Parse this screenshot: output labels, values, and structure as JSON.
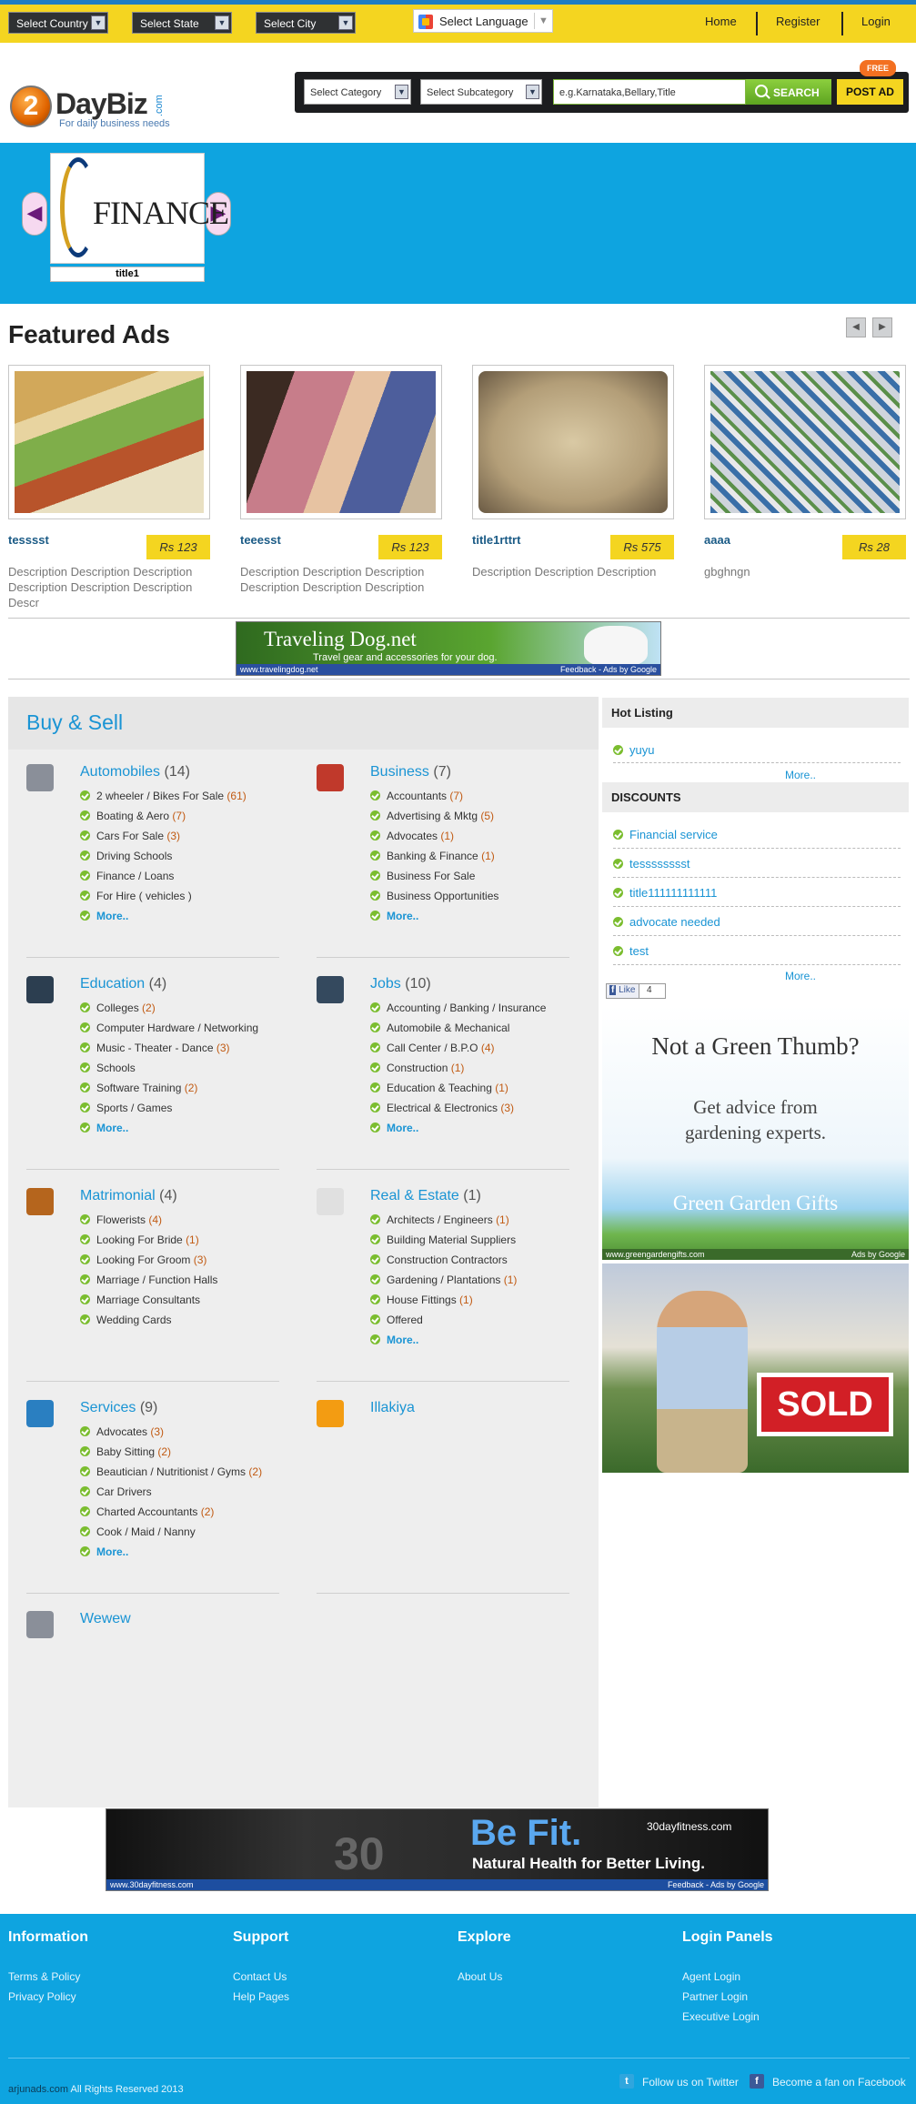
{
  "topbar": {
    "country": "Select Country",
    "state": "Select State",
    "city": "Select City",
    "language": "Select Language",
    "links": [
      "Home",
      "Register",
      "Login"
    ]
  },
  "logo": {
    "main": "2DayBiz",
    "com": ".com",
    "tagline": "For daily business needs"
  },
  "search": {
    "category": "Select Category",
    "subcategory": "Select Subcategory",
    "placeholder": "e.g.Karnataka,Bellary,Title",
    "button": "SEARCH",
    "post": "POST AD",
    "free": "FREE"
  },
  "slider": {
    "caption": "title1",
    "image_text": "FINANCE"
  },
  "featured": {
    "title": "Featured Ads",
    "items": [
      {
        "name": "tesssst",
        "price": "Rs 123",
        "desc": "Description Description Description Description Description Description Descr"
      },
      {
        "name": "teeesst",
        "price": "Rs 123",
        "desc": "Description Description Description Description Description Description"
      },
      {
        "name": "title1rttrt",
        "price": "Rs 575",
        "desc": "Description Description Description"
      },
      {
        "name": "aaaa",
        "price": "Rs 28",
        "desc": "gbghngn"
      }
    ]
  },
  "dog_ad": {
    "title": "Traveling Dog.net",
    "sub": "Travel gear and accessories for your dog.",
    "url": "www.travelingdog.net",
    "feedback": "Feedback - Ads by Google"
  },
  "buysell": {
    "title": "Buy & Sell",
    "more": "More..",
    "categories": [
      {
        "name": "Automobiles",
        "count": "(14)",
        "subs": [
          [
            "2 wheeler / Bikes For Sale",
            "(61)"
          ],
          [
            "Boating & Aero",
            "(7)"
          ],
          [
            "Cars For Sale",
            "(3)"
          ],
          [
            "Driving Schools",
            ""
          ],
          [
            "Finance / Loans",
            ""
          ],
          [
            "For Hire ( vehicles )",
            ""
          ]
        ],
        "more": true
      },
      {
        "name": "Business",
        "count": "(7)",
        "subs": [
          [
            "Accountants",
            "(7)"
          ],
          [
            "Advertising & Mktg",
            "(5)"
          ],
          [
            "Advocates",
            "(1)"
          ],
          [
            "Banking & Finance",
            "(1)"
          ],
          [
            "Business For Sale",
            ""
          ],
          [
            "Business Opportunities",
            ""
          ]
        ],
        "more": true
      },
      {
        "name": "Education",
        "count": "(4)",
        "subs": [
          [
            "Colleges",
            "(2)"
          ],
          [
            "Computer Hardware / Networking",
            ""
          ],
          [
            "Music - Theater - Dance",
            "(3)"
          ],
          [
            "Schools",
            ""
          ],
          [
            "Software Training",
            "(2)"
          ],
          [
            "Sports / Games",
            ""
          ]
        ],
        "more": true
      },
      {
        "name": "Jobs",
        "count": "(10)",
        "subs": [
          [
            "Accounting / Banking / Insurance",
            ""
          ],
          [
            "Automobile & Mechanical",
            ""
          ],
          [
            "Call Center / B.P.O",
            "(4)"
          ],
          [
            "Construction",
            "(1)"
          ],
          [
            "Education & Teaching",
            "(1)"
          ],
          [
            "Electrical & Electronics",
            "(3)"
          ]
        ],
        "more": true
      },
      {
        "name": "Matrimonial",
        "count": "(4)",
        "subs": [
          [
            "Flowerists",
            "(4)"
          ],
          [
            "Looking For Bride",
            "(1)"
          ],
          [
            "Looking For Groom",
            "(3)"
          ],
          [
            "Marriage / Function Halls",
            ""
          ],
          [
            "Marriage Consultants",
            ""
          ],
          [
            "Wedding Cards",
            ""
          ]
        ],
        "more": false
      },
      {
        "name": "Real & Estate",
        "count": "(1)",
        "subs": [
          [
            "Architects / Engineers",
            "(1)"
          ],
          [
            "Building Material Suppliers",
            ""
          ],
          [
            "Construction Contractors",
            ""
          ],
          [
            "Gardening / Plantations",
            "(1)"
          ],
          [
            "House Fittings",
            "(1)"
          ],
          [
            "Offered",
            ""
          ]
        ],
        "more": true
      },
      {
        "name": "Services",
        "count": "(9)",
        "subs": [
          [
            "Advocates",
            "(3)"
          ],
          [
            "Baby Sitting",
            "(2)"
          ],
          [
            "Beautician / Nutritionist / Gyms",
            "(2)"
          ],
          [
            "Car Drivers",
            ""
          ],
          [
            "Charted Accountants",
            "(2)"
          ],
          [
            "Cook / Maid / Nanny",
            ""
          ]
        ],
        "more": true
      },
      {
        "name": "Illakiya",
        "count": "",
        "subs": [],
        "more": false
      },
      {
        "name": "Wewew",
        "count": "",
        "subs": [],
        "more": false
      }
    ]
  },
  "sidebar": {
    "hot_title": "Hot Listing",
    "hot": [
      "yuyu"
    ],
    "disc_title": "DISCOUNTS",
    "discounts": [
      "Financial service",
      "tesssssssst",
      "title111111111111",
      "advocate needed",
      "test"
    ],
    "more": "More..",
    "like": "Like",
    "like_count": "4"
  },
  "green_ad": {
    "head": "Not a Green Thumb?",
    "body1": "Get advice from",
    "body2": "gardening experts.",
    "brand": "Green Garden Gifts",
    "url": "www.greengardengifts.com",
    "feedback": "Ads by Google"
  },
  "sold_ad": {
    "sign": "SOLD"
  },
  "fit_ad": {
    "big": "Be Fit.",
    "sub": "Natural Health for Better Living.",
    "url": "30dayfitness.com",
    "num": "30",
    "footer_url": "www.30dayfitness.com",
    "feedback": "Feedback - Ads by Google"
  },
  "footer": {
    "cols": [
      {
        "title": "Information",
        "links": [
          "Terms & Policy",
          "Privacy Policy"
        ]
      },
      {
        "title": "Support",
        "links": [
          "Contact Us",
          "Help Pages"
        ]
      },
      {
        "title": "Explore",
        "links": [
          "About Us"
        ]
      },
      {
        "title": "Login Panels",
        "links": [
          "Agent Login",
          "Partner Login",
          "Executive Login"
        ]
      }
    ],
    "copy_site": "arjunads.com",
    "copy": "All Rights Reserved 2013",
    "twitter": "Follow us on Twitter",
    "facebook": "Become a fan on Facebook"
  },
  "colors": {
    "accent": "#1a94d4",
    "brand_yellow": "#f4d520",
    "header_blue": "#0ea4e0",
    "green": "#7bbd2f"
  }
}
